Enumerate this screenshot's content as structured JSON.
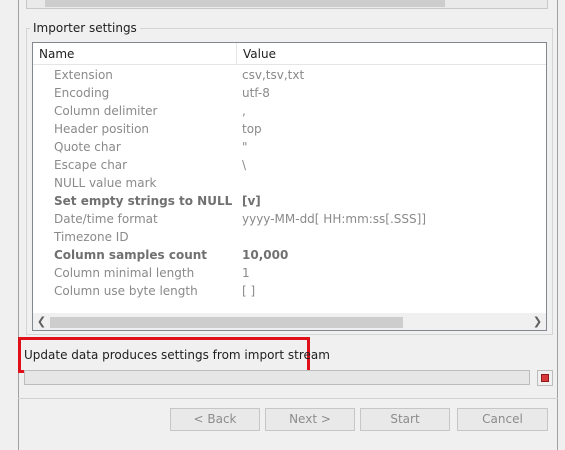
{
  "group": {
    "title": "Importer settings"
  },
  "table": {
    "columns": {
      "name": "Name",
      "value": "Value"
    },
    "rows": [
      {
        "name": "Extension",
        "value": "csv,tsv,txt",
        "bold": false
      },
      {
        "name": "Encoding",
        "value": "utf-8",
        "bold": false
      },
      {
        "name": "Column delimiter",
        "value": ",",
        "bold": false
      },
      {
        "name": "Header position",
        "value": "top",
        "bold": false
      },
      {
        "name": "Quote char",
        "value": "\"",
        "bold": false
      },
      {
        "name": "Escape char",
        "value": "\\",
        "bold": false
      },
      {
        "name": "NULL value mark",
        "value": "",
        "bold": false
      },
      {
        "name": "Set empty strings to NULL",
        "value": "[v]",
        "bold": true
      },
      {
        "name": "Date/time format",
        "value": "yyyy-MM-dd[ HH:mm:ss[.SSS]]",
        "bold": false
      },
      {
        "name": "Timezone ID",
        "value": "",
        "bold": false
      },
      {
        "name": "Column samples count",
        "value": "10,000",
        "bold": true
      },
      {
        "name": "Column minimal length",
        "value": "1",
        "bold": false
      },
      {
        "name": "Column use byte length",
        "value": "[  ]",
        "bold": false
      }
    ],
    "scroll_left_icon": "chevron-left-icon",
    "scroll_right_icon": "chevron-right-icon"
  },
  "status": {
    "text": "Update data produces settings from import stream",
    "highlight_color": "#e0101a"
  },
  "progress": {
    "value": 0,
    "stop_icon": "stop-icon"
  },
  "buttons": {
    "back": "< Back",
    "next": "Next >",
    "start": "Start",
    "cancel": "Cancel"
  }
}
